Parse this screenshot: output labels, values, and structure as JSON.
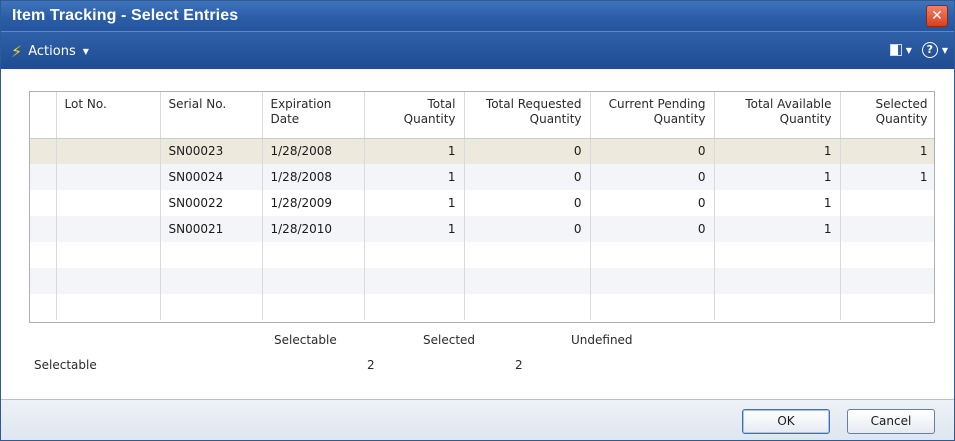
{
  "window": {
    "title": "Item Tracking - Select Entries"
  },
  "actionbar": {
    "actions_label": "Actions"
  },
  "table": {
    "columns": [
      {
        "line1": "",
        "line2": ""
      },
      {
        "line1": "Lot No.",
        "line2": ""
      },
      {
        "line1": "Serial No.",
        "line2": ""
      },
      {
        "line1": "Expiration",
        "line2": "Date"
      },
      {
        "line1": "Total",
        "line2": "Quantity"
      },
      {
        "line1": "Total Requested",
        "line2": "Quantity"
      },
      {
        "line1": "Current Pending",
        "line2": "Quantity"
      },
      {
        "line1": "Total Available",
        "line2": "Quantity"
      },
      {
        "line1": "Selected",
        "line2": "Quantity"
      }
    ],
    "rows": [
      {
        "lot": "",
        "serial": "SN00023",
        "expiration": "1/28/2008",
        "total": "1",
        "requested": "0",
        "pending": "0",
        "available": "1",
        "selected": "1"
      },
      {
        "lot": "",
        "serial": "SN00024",
        "expiration": "1/28/2008",
        "total": "1",
        "requested": "0",
        "pending": "0",
        "available": "1",
        "selected": "1"
      },
      {
        "lot": "",
        "serial": "SN00022",
        "expiration": "1/28/2009",
        "total": "1",
        "requested": "0",
        "pending": "0",
        "available": "1",
        "selected": ""
      },
      {
        "lot": "",
        "serial": "SN00021",
        "expiration": "1/28/2010",
        "total": "1",
        "requested": "0",
        "pending": "0",
        "available": "1",
        "selected": ""
      },
      {
        "lot": "",
        "serial": "",
        "expiration": "",
        "total": "",
        "requested": "",
        "pending": "",
        "available": "",
        "selected": ""
      },
      {
        "lot": "",
        "serial": "",
        "expiration": "",
        "total": "",
        "requested": "",
        "pending": "",
        "available": "",
        "selected": ""
      },
      {
        "lot": "",
        "serial": "",
        "expiration": "",
        "total": "",
        "requested": "",
        "pending": "",
        "available": "",
        "selected": ""
      }
    ]
  },
  "summary": {
    "header_selectable": "Selectable",
    "header_selected": "Selected",
    "header_undefined": "Undefined",
    "row_label": "Selectable",
    "selectable_value": "2",
    "selected_value": "2"
  },
  "footer": {
    "ok_label": "OK",
    "cancel_label": "Cancel"
  },
  "icons": {
    "actions": "lightning-bolt-icon",
    "close": "close-icon",
    "layout": "layout-icon",
    "help": "help-icon"
  },
  "colors": {
    "titlebar": "#2b5ea7",
    "actionbar": "#1f4c93",
    "close_button": "#d8411f",
    "active_row": "#ede9dc",
    "bolt": "#ffcc22"
  }
}
